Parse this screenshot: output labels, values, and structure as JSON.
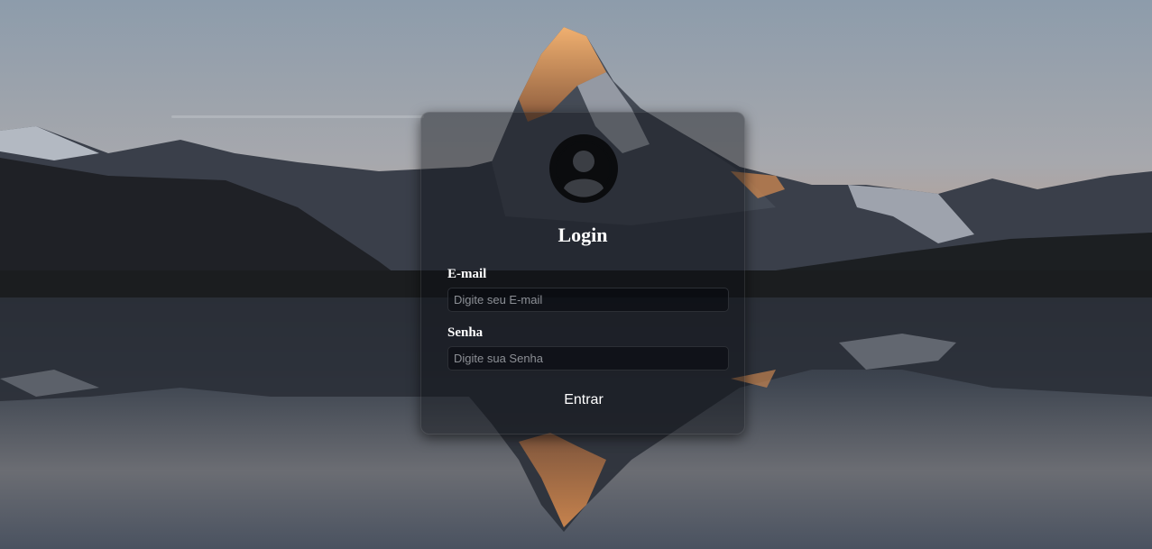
{
  "background": {
    "sky_top": "#8f9eac",
    "sky_bottom": "#c09a82",
    "mountain": "#2c313b",
    "peak_glow": "#d98a4a",
    "snow": "#cfd5dc",
    "water": "#3a3f4a"
  },
  "login": {
    "avatar_icon": "user-circle-icon",
    "title": "Login",
    "email_label": "E-mail",
    "email_placeholder": "Digite seu E-mail",
    "email_value": "",
    "password_label": "Senha",
    "password_placeholder": "Digite sua Senha",
    "password_value": "",
    "submit_label": "Entrar"
  }
}
